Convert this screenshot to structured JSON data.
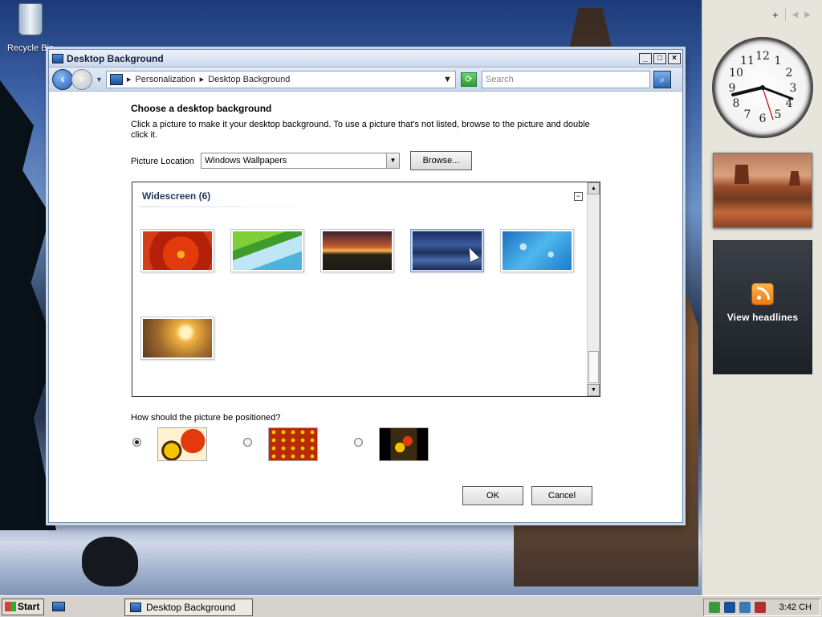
{
  "desktop": {
    "recycle_bin_label": "Recycle Bin"
  },
  "window": {
    "title": "Desktop Background",
    "controls": {
      "minimize": "_",
      "maximize": "□",
      "close": "×"
    },
    "nav": {
      "back_icon": "arrow-left-icon",
      "breadcrumb": [
        "Personalization",
        "Desktop Background"
      ],
      "search_placeholder": "Search"
    },
    "heading": "Choose a desktop background",
    "description": "Click a picture to make it your desktop background. To use a picture that's not listed, browse to the picture and double click it.",
    "picture_location_label": "Picture Location",
    "picture_location_value": "Windows Wallpapers",
    "browse_label": "Browse...",
    "group": {
      "label": "Widescreen (6)",
      "collapse_glyph": "−"
    },
    "thumbnails": [
      {
        "name": "red-flower",
        "selected": false
      },
      {
        "name": "palm-leaf",
        "selected": false
      },
      {
        "name": "sunset-hills",
        "selected": false
      },
      {
        "name": "mountain-lake",
        "selected": true
      },
      {
        "name": "water-drops",
        "selected": false
      },
      {
        "name": "golden-field",
        "selected": false
      }
    ],
    "position_question": "How should the picture be positioned?",
    "position_options": [
      {
        "name": "fit-to-screen",
        "selected": true
      },
      {
        "name": "tile",
        "selected": false
      },
      {
        "name": "center",
        "selected": false
      }
    ],
    "ok_label": "OK",
    "cancel_label": "Cancel"
  },
  "sidebar": {
    "add_label": "+",
    "prev_label": "◀",
    "next_label": "▶",
    "clock_numbers": [
      "12",
      "1",
      "2",
      "3",
      "4",
      "5",
      "6",
      "7",
      "8",
      "9",
      "10",
      "11"
    ],
    "feed_label": "View headlines"
  },
  "taskbar": {
    "start_label": "Start",
    "task_label": "Desktop Background",
    "time": "3:42 CH"
  }
}
